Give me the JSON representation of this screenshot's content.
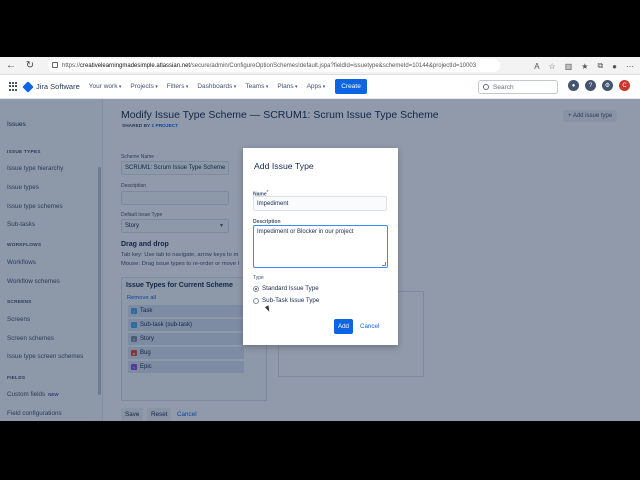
{
  "browser": {
    "url_prefix": "https://",
    "url_host": "creativelearningmadesimple.atlassian.net",
    "url_path": "/secure/admin/ConfigureOptionSchemes!default.jspa?fieldId=issuetype&schemeId=10144&projectId=10003"
  },
  "topnav": {
    "product": "Jira Software",
    "items": [
      "Your work",
      "Projects",
      "Filters",
      "Dashboards",
      "Teams",
      "Plans",
      "Apps"
    ],
    "create_label": "Create",
    "search_placeholder": "Search",
    "avatar_initial": "C"
  },
  "sidebar": {
    "title": "Issues",
    "sections": [
      {
        "heading": "ISSUE TYPES",
        "links": [
          "Issue type hierarchy",
          "Issue types",
          "Issue type schemes",
          "Sub-tasks"
        ]
      },
      {
        "heading": "WORKFLOWS",
        "links": [
          "Workflows",
          "Workflow schemes"
        ]
      },
      {
        "heading": "SCREENS",
        "links": [
          "Screens",
          "Screen schemes",
          "Issue type screen schemes"
        ]
      },
      {
        "heading": "FIELDS",
        "links": [
          "Custom fields",
          "Field configurations"
        ]
      }
    ],
    "new_badge": "NEW"
  },
  "page": {
    "title": "Modify Issue Type Scheme — SCRUM1: Scrum Issue Type Scheme",
    "shared_prefix": "SHARED BY",
    "shared_link": "1 PROJECT",
    "add_issue_type": "+ Add issue type",
    "scheme_name_label": "Scheme Name",
    "scheme_name_value": "SCRUM1: Scrum Issue Type Scheme",
    "description_label": "Description",
    "description_value": "",
    "default_type_label": "Default Issue Type",
    "default_type_value": "Story",
    "drag_title": "Drag and drop",
    "drag_line1": "Tab key: Use tab to navigate, arrow keys to m",
    "drag_line2": "Mouse: Drag issue types to re-order or move I",
    "types_heading": "Issue Types for Current Scheme",
    "remove_all": "Remove all",
    "types": [
      {
        "name": "Task",
        "color": "#4bade8",
        "icon": "check-square-icon"
      },
      {
        "name": "Sub-task (sub-task)",
        "color": "#4bade8",
        "icon": "subtask-icon"
      },
      {
        "name": "Story",
        "color": "#8590a2",
        "icon": "story-icon"
      },
      {
        "name": "Bug",
        "color": "#e5493a",
        "icon": "bug-icon"
      },
      {
        "name": "Epic",
        "color": "#904ee2",
        "icon": "epic-icon"
      }
    ],
    "save_label": "Save",
    "reset_label": "Reset",
    "cancel_label": "Cancel"
  },
  "modal": {
    "title": "Add Issue Type",
    "name_label": "Name",
    "name_value": "Impediment",
    "description_label": "Description",
    "description_value": "Impediment or Blocker in our project",
    "type_label": "Type",
    "option_standard": "Standard Issue Type",
    "option_subtask": "Sub-Task Issue Type",
    "selected": "Standard Issue Type",
    "add_label": "Add",
    "cancel_label": "Cancel"
  }
}
